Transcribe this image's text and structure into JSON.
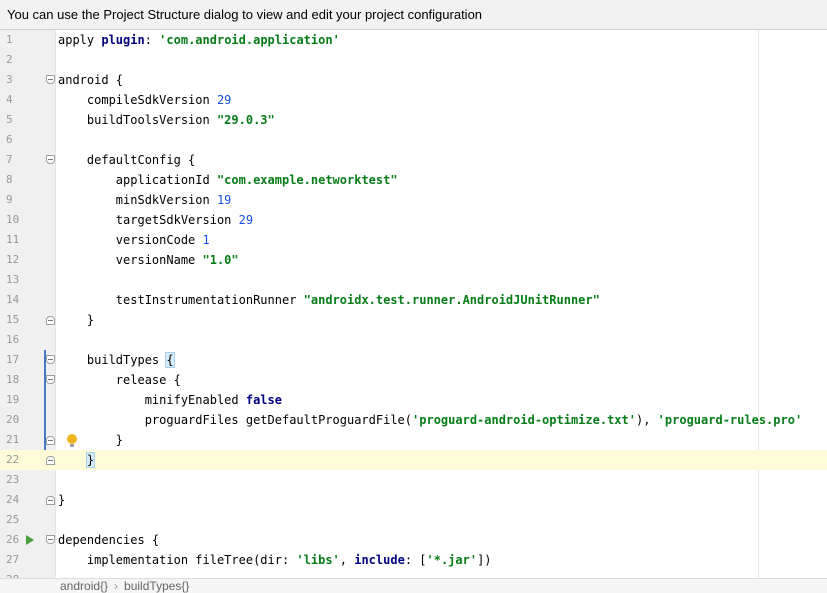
{
  "banner": {
    "text": "You can use the Project Structure dialog to view and edit your project configuration"
  },
  "editor": {
    "lines": [
      {
        "n": "1",
        "tokens": [
          [
            "apply ",
            ""
          ],
          [
            "plugin",
            "kw"
          ],
          [
            ": ",
            ""
          ],
          [
            "'com.android.application'",
            "str"
          ]
        ]
      },
      {
        "n": "2",
        "tokens": []
      },
      {
        "n": "3",
        "fold": "open",
        "tokens": [
          [
            "android {",
            ""
          ]
        ]
      },
      {
        "n": "4",
        "tokens": [
          [
            "    compileSdkVersion ",
            ""
          ],
          [
            "29",
            "num"
          ]
        ]
      },
      {
        "n": "5",
        "tokens": [
          [
            "    buildToolsVersion ",
            ""
          ],
          [
            "\"29.0.3\"",
            "str"
          ]
        ]
      },
      {
        "n": "6",
        "tokens": []
      },
      {
        "n": "7",
        "fold": "open",
        "tokens": [
          [
            "    defaultConfig {",
            ""
          ]
        ]
      },
      {
        "n": "8",
        "tokens": [
          [
            "        applicationId ",
            ""
          ],
          [
            "\"com.example.networktest\"",
            "str"
          ]
        ]
      },
      {
        "n": "9",
        "tokens": [
          [
            "        minSdkVersion ",
            ""
          ],
          [
            "19",
            "num"
          ]
        ]
      },
      {
        "n": "10",
        "tokens": [
          [
            "        targetSdkVersion ",
            ""
          ],
          [
            "29",
            "num"
          ]
        ]
      },
      {
        "n": "11",
        "tokens": [
          [
            "        versionCode ",
            ""
          ],
          [
            "1",
            "num"
          ]
        ]
      },
      {
        "n": "12",
        "tokens": [
          [
            "        versionName ",
            ""
          ],
          [
            "\"1.0\"",
            "str"
          ]
        ]
      },
      {
        "n": "13",
        "tokens": []
      },
      {
        "n": "14",
        "tokens": [
          [
            "        testInstrumentationRunner ",
            ""
          ],
          [
            "\"androidx.test.runner.AndroidJUnitRunner\"",
            "str"
          ]
        ]
      },
      {
        "n": "15",
        "fold": "close",
        "tokens": [
          [
            "    }",
            ""
          ]
        ]
      },
      {
        "n": "16",
        "tokens": []
      },
      {
        "n": "17",
        "fold": "open",
        "tokens": [
          [
            "    buildTypes ",
            ""
          ],
          [
            "{",
            "hl"
          ]
        ]
      },
      {
        "n": "18",
        "fold": "open",
        "tokens": [
          [
            "        release {",
            ""
          ]
        ]
      },
      {
        "n": "19",
        "tokens": [
          [
            "            minifyEnabled ",
            ""
          ],
          [
            "false",
            "kw"
          ]
        ]
      },
      {
        "n": "20",
        "tokens": [
          [
            "            proguardFiles getDefaultProguardFile(",
            ""
          ],
          [
            "'proguard-android-optimize.txt'",
            "str"
          ],
          [
            "), ",
            ""
          ],
          [
            "'proguard-rules.pro'",
            "str"
          ]
        ]
      },
      {
        "n": "21",
        "fold": "close",
        "bulb": true,
        "tokens": [
          [
            "        }",
            ""
          ]
        ]
      },
      {
        "n": "22",
        "fold": "close",
        "current": true,
        "tokens": [
          [
            "    ",
            ""
          ],
          [
            "}",
            "hl"
          ]
        ]
      },
      {
        "n": "23",
        "tokens": []
      },
      {
        "n": "24",
        "fold": "close",
        "tokens": [
          [
            "}",
            ""
          ]
        ]
      },
      {
        "n": "25",
        "tokens": []
      },
      {
        "n": "26",
        "fold": "open",
        "run": true,
        "tokens": [
          [
            "dependencies {",
            ""
          ]
        ]
      },
      {
        "n": "27",
        "tokens": [
          [
            "    implementation fileTree(dir: ",
            ""
          ],
          [
            "'libs'",
            "str"
          ],
          [
            ", ",
            ""
          ],
          [
            "include",
            "kw"
          ],
          [
            ": [",
            ""
          ],
          [
            "'*.jar'",
            "str"
          ],
          [
            "])",
            ""
          ]
        ]
      },
      {
        "n": "28",
        "tokens": []
      }
    ]
  },
  "breadcrumb": {
    "items": [
      "android{}",
      "buildTypes{}"
    ]
  },
  "colors": {
    "keyword": "#000080",
    "string": "#067d17",
    "number": "#1750eb",
    "current_line": "#fefbd9",
    "brace_highlight": "#d6ebfb",
    "gutter": "#f0f0f0"
  }
}
